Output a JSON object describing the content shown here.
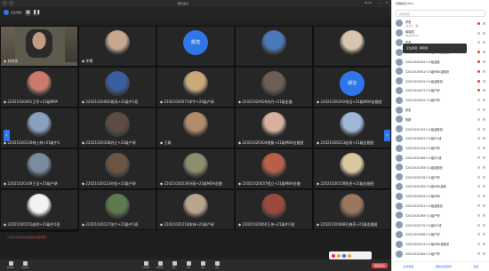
{
  "window": {
    "title": "腾讯会议",
    "time": "01:07",
    "speaker_label": "正在讲话：",
    "meeting_label": "会议号"
  },
  "grid": {
    "camera_tile": {
      "name": "◆ 韩晓丽"
    },
    "tiles": [
      {
        "name": "◆ 李慧",
        "avatar": "photo",
        "color": "#c7a88e"
      },
      {
        "name": "",
        "avatar": "text",
        "avatar_text": "颜茂"
      },
      {
        "name": "",
        "avatar": "photo",
        "color": "#4a78b8"
      },
      {
        "name": "",
        "avatar": "photo",
        "color": "#d8c5b0"
      },
      {
        "name": "◆ 22021020401王军+21级MPA",
        "avatar": "photo",
        "color": "#c97c6e"
      },
      {
        "name": "◆ 22021020081杨涛+21级中1班",
        "avatar": "photo",
        "color": "#3a5fa0"
      },
      {
        "name": "◆ 22021020071李宇+21级产研",
        "avatar": "photo",
        "color": "#caa87a"
      },
      {
        "name": "◆ 22021020028刘丹+21级金融",
        "avatar": "photo",
        "color": "#6e5e58"
      },
      {
        "name": "◆ 22021020292胡洁+21级MBA金融班",
        "avatar": "text",
        "avatar_text": "胡洁"
      },
      {
        "name": "◆ 22021020130林士林+21级中1",
        "avatar": "photo",
        "color": "#8aa0c0"
      },
      {
        "name": "◆ 22021020108苏立+21级产研",
        "avatar": "photo",
        "color": "#5e4c44"
      },
      {
        "name": "◆ 王瑜",
        "avatar": "photo",
        "color": "#b28b6b"
      },
      {
        "name": "◆ 22021020304曾磊+21级MBA金融班",
        "avatar": "photo",
        "color": "#d7b09f"
      },
      {
        "name": "◆ 22021020213赵雨+21级金融班",
        "avatar": "photo",
        "color": "#a0b8d8"
      },
      {
        "name": "◆ 22021020149王浩+21级产研",
        "avatar": "photo",
        "color": "#7a8c9e"
      },
      {
        "name": "◆ 22021020123刘佳+21级产研",
        "avatar": "photo",
        "color": "#6d5542"
      },
      {
        "name": "◆ 22021020236孙丽+21级MBA金融",
        "avatar": "photo",
        "color": "#8d8d6e"
      },
      {
        "name": "◆ 22021020037程立+21级MBA金融",
        "avatar": "photo",
        "color": "#b85f4a"
      },
      {
        "name": "◆ 22021020158陈亮+21级金融班",
        "avatar": "photo",
        "color": "#d9c9a0"
      },
      {
        "name": "◆ 22021020151赵明+21级中1班",
        "avatar": "photo",
        "color": "#f2f2f2"
      },
      {
        "name": "◆ 22021020127张宁+21级中1班",
        "avatar": "photo",
        "color": "#5f7a50"
      },
      {
        "name": "◆ 22021020216陈林+21级产研",
        "avatar": "photo",
        "color": "#b7a58e"
      },
      {
        "name": "◆ 22021020060王伟+21级中1班",
        "avatar": "photo",
        "color": "#9d4a3e"
      },
      {
        "name": "◆ 22021020088孔晓亮+21级金融班",
        "avatar": "photo",
        "color": "#9a7860"
      },
      {
        "name": "◆ 22021020037唐利+21级中1班",
        "avatar": "photo",
        "color": "#cfb8a8"
      }
    ],
    "overlay_text": "22021020227刘林 21级产研"
  },
  "toolbar": {
    "left": [
      {
        "icon": "mic-icon",
        "label": "解除静音"
      },
      {
        "icon": "video-icon",
        "label": "开启视频"
      }
    ],
    "center": [
      {
        "icon": "share-icon",
        "label": "共享屏幕"
      },
      {
        "icon": "members-icon",
        "label": "管理成员"
      },
      {
        "icon": "chat-icon",
        "label": "聊天"
      },
      {
        "icon": "record-icon",
        "label": "录制"
      },
      {
        "icon": "apps-icon",
        "label": "应用"
      },
      {
        "icon": "settings-icon",
        "label": "设置"
      }
    ],
    "end_label": "结束会议"
  },
  "panel": {
    "title": "管理成员(353)",
    "search_placeholder": "搜索成员",
    "popup_text": "正在讲话：韩晓丽",
    "members": [
      {
        "name": "李慧",
        "sub": "(主持人，我)",
        "icon": "red"
      },
      {
        "name": "韩晓丽",
        "sub": "(联席主持人)",
        "icon": "grey"
      },
      {
        "name": "严茂",
        "sub": "",
        "icon": "grey"
      },
      {
        "name": "22021020129+21级MBA金融班",
        "sub": "",
        "icon": "red"
      },
      {
        "name": "22021020305+21级金融",
        "sub": "",
        "icon": "red"
      },
      {
        "name": "22021020001+21级MBA金融班",
        "sub": "",
        "icon": "red"
      },
      {
        "name": "22021020019+21级金融班",
        "sub": "",
        "icon": "red"
      },
      {
        "name": "22021020037+21级产研",
        "sub": "",
        "icon": "red"
      },
      {
        "name": "22021020022+21级产研",
        "sub": "",
        "icon": "grey"
      },
      {
        "name": "张宏",
        "sub": "",
        "icon": "grey"
      },
      {
        "name": "陈刚",
        "sub": "",
        "icon": "grey"
      },
      {
        "name": "22021020103+21级金融班",
        "sub": "",
        "icon": "grey"
      },
      {
        "name": "22021020091+21级中1班",
        "sub": "",
        "icon": "grey"
      },
      {
        "name": "22021020124+21级产研",
        "sub": "",
        "icon": "grey"
      },
      {
        "name": "22021020186+21级中1班",
        "sub": "",
        "icon": "grey"
      },
      {
        "name": "22021020155+21级金融班",
        "sub": "",
        "icon": "grey"
      },
      {
        "name": "22021020078+21级产研",
        "sub": "",
        "icon": "grey"
      },
      {
        "name": "22021020162+21级MBA金融",
        "sub": "",
        "icon": "grey"
      },
      {
        "name": "22021020044+21级MBA",
        "sub": "",
        "icon": "grey"
      },
      {
        "name": "22021020301+21级金融班",
        "sub": "",
        "icon": "grey"
      },
      {
        "name": "22021020265+21级产研",
        "sub": "",
        "icon": "grey"
      },
      {
        "name": "22021020175+21级中1班",
        "sub": "",
        "icon": "grey"
      },
      {
        "name": "22021020058+21级产研",
        "sub": "",
        "icon": "grey"
      },
      {
        "name": "22021020214+21级MBA金融班",
        "sub": "",
        "icon": "grey"
      },
      {
        "name": "22021020284+21级产研",
        "sub": "",
        "icon": "grey"
      }
    ],
    "footer": [
      "全体静音",
      "解除全体静音",
      "更多"
    ]
  }
}
